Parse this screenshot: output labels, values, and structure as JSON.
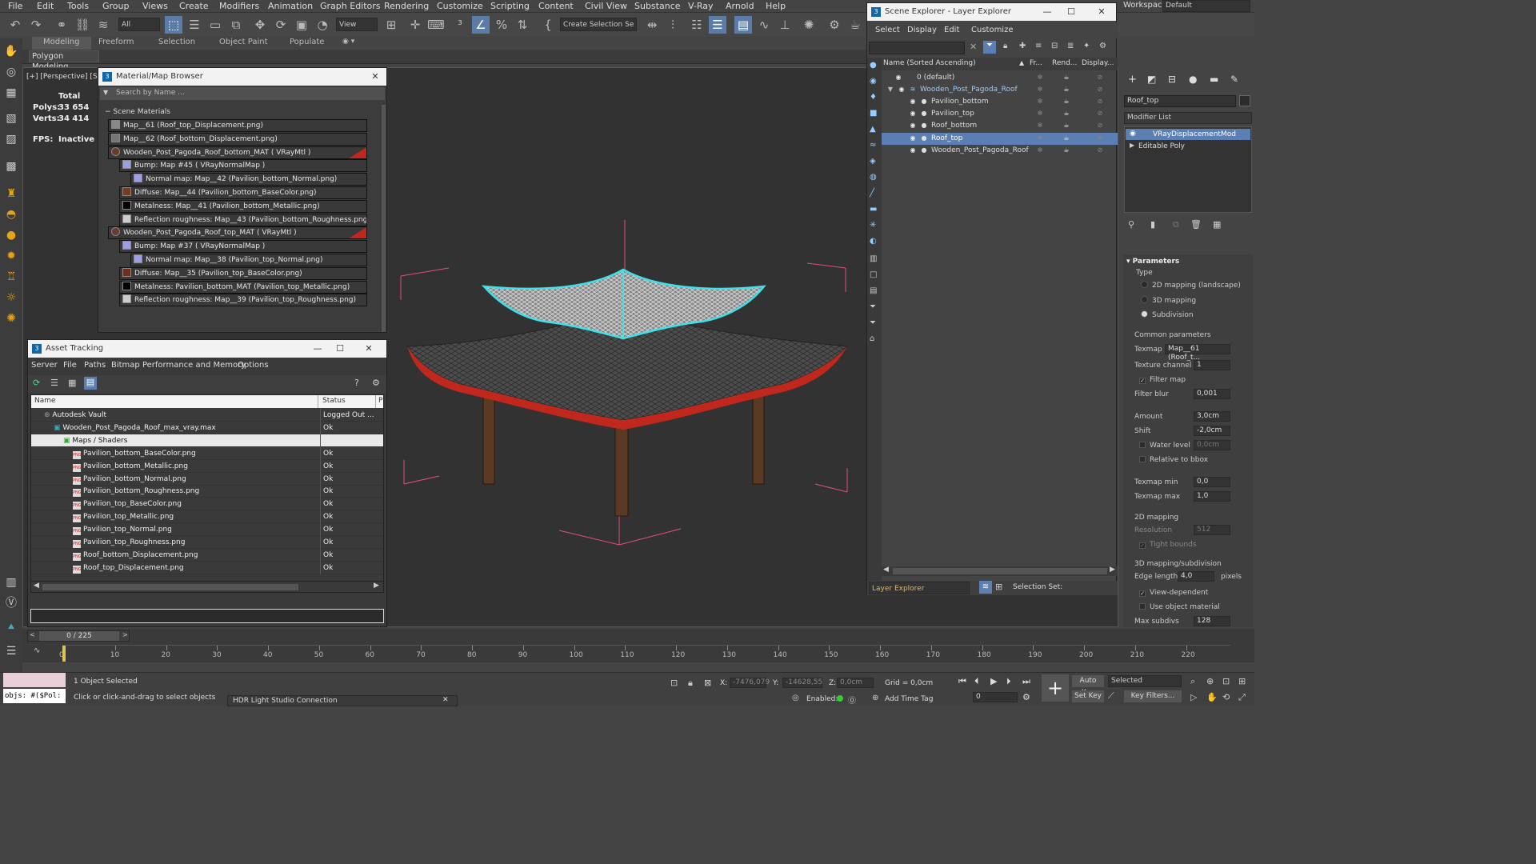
{
  "menu": [
    "File",
    "Edit",
    "Tools",
    "Group",
    "Views",
    "Create",
    "Modifiers",
    "Animation",
    "Graph Editors",
    "Rendering",
    "Customize",
    "Scripting",
    "Content",
    "Civil View",
    "Substance",
    "V-Ray",
    "Arnold",
    "Help"
  ],
  "workspaces": {
    "label": "Workspaces:",
    "value": "Default"
  },
  "toolbar": {
    "filter_value": "All",
    "view_value": "View",
    "selection_set_placeholder": "Create Selection Se"
  },
  "ribbon": {
    "tabs": [
      "Modeling",
      "Freeform",
      "Selection",
      "Object Paint",
      "Populate"
    ],
    "sub": "Polygon Modeling"
  },
  "viewport": {
    "label": "[+] [Perspective] [St",
    "stats": {
      "total_label": "Total",
      "polys_label": "Polys:",
      "polys": "33 654",
      "verts_label": "Verts:",
      "verts": "34 414",
      "fps_label": "FPS:",
      "fps": "Inactive"
    }
  },
  "material_browser": {
    "title": "Material/Map Browser",
    "search_placeholder": "Search by Name ...",
    "group": "Scene Materials",
    "rows": [
      {
        "text": "Map__61 (Roof_top_Displacement.png)",
        "indent": 0,
        "swatch": "#888"
      },
      {
        "text": "Map__62 (Roof_bottom_Displacement.png)",
        "indent": 0,
        "swatch": "#777"
      },
      {
        "text": "Wooden_Post_Pagoda_Roof_bottom_MAT ( VRayMtl )",
        "indent": 0,
        "swatch": "#6a3a2a",
        "mat": true
      },
      {
        "text": "Bump: Map #45  ( VRayNormalMap )",
        "indent": 1,
        "swatch": "#9aa0e0"
      },
      {
        "text": "Normal map: Map__42 (Pavilion_bottom_Normal.png)",
        "indent": 2,
        "swatch": "#9aa0e0"
      },
      {
        "text": "Diffuse: Map__44 (Pavilion_bottom_BaseColor.png)",
        "indent": 1,
        "swatch": "#7a3a20"
      },
      {
        "text": "Metalness: Map__41 (Pavilion_bottom_Metallic.png)",
        "indent": 1,
        "swatch": "#000"
      },
      {
        "text": "Reflection roughness: Map__43 (Pavilion_bottom_Roughness.png)",
        "indent": 1,
        "swatch": "#ccc"
      },
      {
        "text": "Wooden_Post_Pagoda_Roof_top_MAT ( VRayMtl )",
        "indent": 0,
        "swatch": "#6a3a2a",
        "mat": true
      },
      {
        "text": "Bump: Map #37  ( VRayNormalMap )",
        "indent": 1,
        "swatch": "#9aa0e0"
      },
      {
        "text": "Normal map: Map__38 (Pavilion_top_Normal.png)",
        "indent": 2,
        "swatch": "#9aa0e0"
      },
      {
        "text": "Diffuse: Map__35 (Pavilion_top_BaseColor.png)",
        "indent": 1,
        "swatch": "#6a3020"
      },
      {
        "text": "Metalness: Pavilion_bottom_MAT (Pavilion_top_Metallic.png)",
        "indent": 1,
        "swatch": "#000"
      },
      {
        "text": "Reflection roughness: Map__39 (Pavilion_top_Roughness.png)",
        "indent": 1,
        "swatch": "#ccc"
      }
    ]
  },
  "asset_tracking": {
    "title": "Asset Tracking",
    "menu": [
      "Server",
      "File",
      "Paths",
      "Bitmap Performance and Memory",
      "Options"
    ],
    "col_name": "Name",
    "col_status": "Status",
    "col_p": "P",
    "rows": [
      {
        "name": "Autodesk Vault",
        "status": "Logged Out ...",
        "indent": 1,
        "kind": "vault"
      },
      {
        "name": "Wooden_Post_Pagoda_Roof_max_vray.max",
        "status": "Ok",
        "indent": 2,
        "kind": "max"
      },
      {
        "name": "Maps / Shaders",
        "status": "",
        "indent": 3,
        "kind": "folder"
      },
      {
        "name": "Pavilion_bottom_BaseColor.png",
        "status": "Ok",
        "indent": 4,
        "kind": "png"
      },
      {
        "name": "Pavilion_bottom_Metallic.png",
        "status": "Ok",
        "indent": 4,
        "kind": "png"
      },
      {
        "name": "Pavilion_bottom_Normal.png",
        "status": "Ok",
        "indent": 4,
        "kind": "png"
      },
      {
        "name": "Pavilion_bottom_Roughness.png",
        "status": "Ok",
        "indent": 4,
        "kind": "png"
      },
      {
        "name": "Pavilion_top_BaseColor.png",
        "status": "Ok",
        "indent": 4,
        "kind": "png"
      },
      {
        "name": "Pavilion_top_Metallic.png",
        "status": "Ok",
        "indent": 4,
        "kind": "png"
      },
      {
        "name": "Pavilion_top_Normal.png",
        "status": "Ok",
        "indent": 4,
        "kind": "png"
      },
      {
        "name": "Pavilion_top_Roughness.png",
        "status": "Ok",
        "indent": 4,
        "kind": "png"
      },
      {
        "name": "Roof_bottom_Displacement.png",
        "status": "Ok",
        "indent": 4,
        "kind": "png"
      },
      {
        "name": "Roof_top_Displacement.png",
        "status": "Ok",
        "indent": 4,
        "kind": "png"
      }
    ]
  },
  "scene_explorer": {
    "title": "Scene Explorer - Layer Explorer",
    "menu": [
      "Select",
      "Display",
      "Edit",
      "Customize"
    ],
    "cols": {
      "name": "Name (Sorted Ascending)",
      "freeze": "Fr...",
      "render": "Rend...",
      "display": "Display..."
    },
    "rows": [
      {
        "name": "0 (default)",
        "indent": 1,
        "selected": false
      },
      {
        "name": "Wooden_Post_Pagoda_Roof",
        "indent": 1,
        "selected": false,
        "layer": true
      },
      {
        "name": "Pavilion_bottom",
        "indent": 2,
        "selected": false
      },
      {
        "name": "Pavilion_top",
        "indent": 2,
        "selected": false
      },
      {
        "name": "Roof_bottom",
        "indent": 2,
        "selected": false
      },
      {
        "name": "Roof_top",
        "indent": 2,
        "selected": true
      },
      {
        "name": "Wooden_Post_Pagoda_Roof",
        "indent": 2,
        "selected": false
      }
    ],
    "footer_combo": "Layer Explorer",
    "selection_set_label": "Selection Set:"
  },
  "command_panel": {
    "object_name": "Roof_top",
    "modifier_list": "Modifier List",
    "stack": [
      "VRayDisplacementMod",
      "Editable Poly"
    ],
    "rollout": "Parameters",
    "type_label": "Type",
    "types": [
      "2D mapping (landscape)",
      "3D mapping",
      "Subdivision"
    ],
    "type_selected": 2,
    "common_label": "Common parameters",
    "texmap_label": "Texmap",
    "texmap_value": "Map__61 (Roof_t...",
    "texture_channel_label": "Texture channel",
    "texture_channel": "1",
    "filter_map_label": "Filter map",
    "filter_blur_label": "Filter blur",
    "filter_blur": "0,001",
    "amount_label": "Amount",
    "amount": "3,0cm",
    "shift_label": "Shift",
    "shift": "-2,0cm",
    "water_level_label": "Water level",
    "water_level": "0,0cm",
    "relative_bbox_label": "Relative to bbox",
    "texmap_min_label": "Texmap min",
    "texmap_min": "0,0",
    "texmap_max_label": "Texmap max",
    "texmap_max": "1,0",
    "mapping2d_label": "2D mapping",
    "resolution_label": "Resolution",
    "resolution": "512",
    "tight_bounds_label": "Tight bounds",
    "mapping3d_label": "3D mapping/subdivision",
    "edge_length_label": "Edge length",
    "edge_length": "4,0",
    "pixels_label": "pixels",
    "view_dependent_label": "View-dependent",
    "use_object_material_label": "Use object material",
    "max_subdivs_label": "Max subdivs",
    "max_subdivs": "128"
  },
  "timeline": {
    "frame": "0 / 225",
    "ticks": [
      "0",
      "10",
      "20",
      "30",
      "40",
      "50",
      "60",
      "70",
      "80",
      "90",
      "100",
      "110",
      "120",
      "130",
      "140",
      "150",
      "160",
      "170",
      "180",
      "190",
      "200",
      "210",
      "220"
    ]
  },
  "status": {
    "script_value": "objs: #($Pol:",
    "selected_text": "1 Object Selected",
    "hint": "Click or click-and-drag to select objects",
    "hdr_tab": "HDR Light Studio Connection",
    "x_label": "X:",
    "x": "-7476,079",
    "y_label": "Y:",
    "y": "-14628,55",
    "z_label": "Z:",
    "z": "0,0cm",
    "grid": "Grid = 0,0cm",
    "enabled_label": "Enabled:",
    "add_time_tag": "Add Time Tag",
    "auto_key": "Auto Key",
    "set_key": "Set Key",
    "key_mode": "Selected",
    "key_filters": "Key Filters...",
    "frame_value": "0"
  },
  "colors": {
    "accent": "#5b7fb2",
    "selection_cyan": "#3fe0e8",
    "bbox": "#e0507a",
    "roof_red": "#c0281e"
  }
}
